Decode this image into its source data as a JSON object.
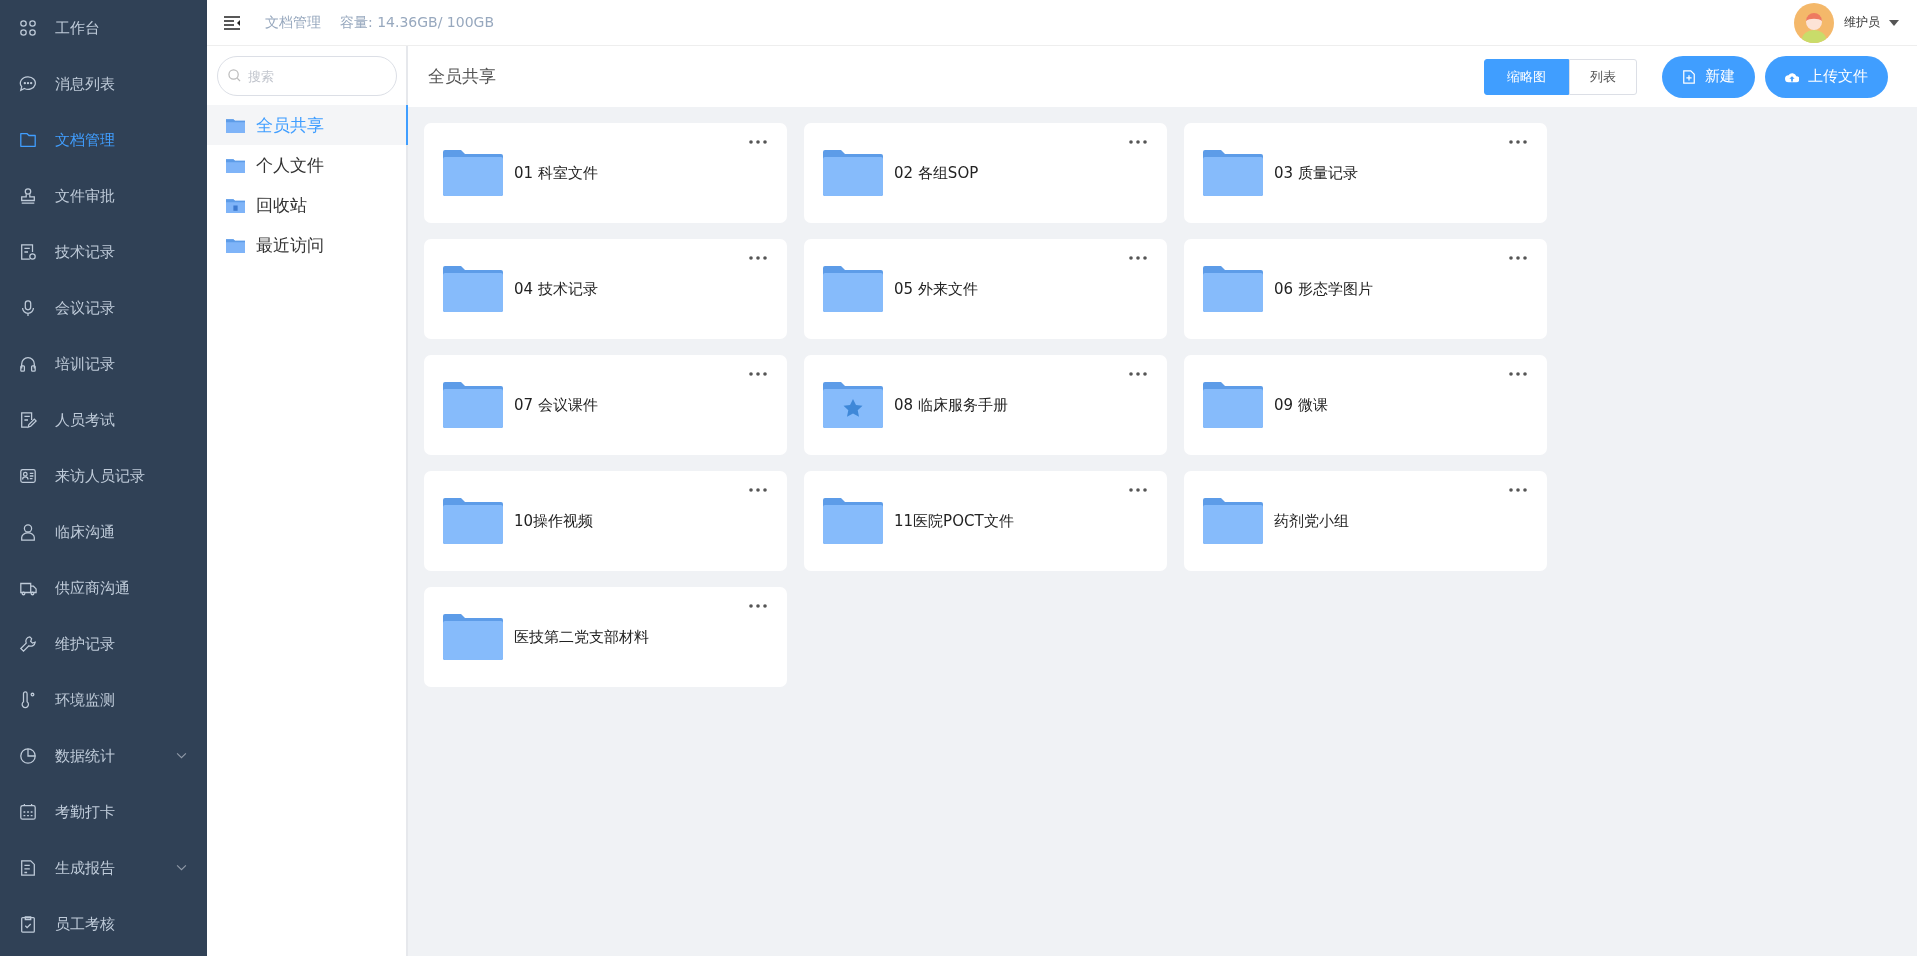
{
  "sidebar": {
    "items": [
      {
        "label": "工作台",
        "selected": false,
        "expandable": false
      },
      {
        "label": "消息列表",
        "selected": false,
        "expandable": false
      },
      {
        "label": "文档管理",
        "selected": true,
        "expandable": false
      },
      {
        "label": "文件审批",
        "selected": false,
        "expandable": false
      },
      {
        "label": "技术记录",
        "selected": false,
        "expandable": false
      },
      {
        "label": "会议记录",
        "selected": false,
        "expandable": false
      },
      {
        "label": "培训记录",
        "selected": false,
        "expandable": false
      },
      {
        "label": "人员考试",
        "selected": false,
        "expandable": false
      },
      {
        "label": "来访人员记录",
        "selected": false,
        "expandable": false
      },
      {
        "label": "临床沟通",
        "selected": false,
        "expandable": false
      },
      {
        "label": "供应商沟通",
        "selected": false,
        "expandable": false
      },
      {
        "label": "维护记录",
        "selected": false,
        "expandable": false
      },
      {
        "label": "环境监测",
        "selected": false,
        "expandable": false
      },
      {
        "label": "数据统计",
        "selected": false,
        "expandable": true
      },
      {
        "label": "考勤打卡",
        "selected": false,
        "expandable": false
      },
      {
        "label": "生成报告",
        "selected": false,
        "expandable": true
      },
      {
        "label": "员工考核",
        "selected": false,
        "expandable": false
      }
    ]
  },
  "header": {
    "breadcrumb": "文档管理",
    "capacity": "容量: 14.36GB/ 100GB",
    "user": "维护员"
  },
  "folder_panel": {
    "search": {
      "placeholder": "搜索"
    },
    "items": [
      {
        "label": "全员共享",
        "kind": "folder",
        "selected": true
      },
      {
        "label": "个人文件",
        "kind": "folder",
        "selected": false
      },
      {
        "label": "回收站",
        "kind": "trash",
        "selected": false
      },
      {
        "label": "最近访问",
        "kind": "folder",
        "selected": false
      }
    ]
  },
  "content": {
    "title": "全员共享",
    "view_toggle": [
      {
        "label": "缩略图",
        "selected": true
      },
      {
        "label": "列表",
        "selected": false
      }
    ],
    "buttons": [
      {
        "label": "新建",
        "kind": "new"
      },
      {
        "label": "上传文件",
        "kind": "upload"
      }
    ],
    "folders": [
      {
        "name": "01 科室文件",
        "starred": false
      },
      {
        "name": "02 各组SOP",
        "starred": false
      },
      {
        "name": "03 质量记录",
        "starred": false
      },
      {
        "name": "04 技术记录",
        "starred": false
      },
      {
        "name": "05 外来文件",
        "starred": false
      },
      {
        "name": "06 形态学图片",
        "starred": false
      },
      {
        "name": "07 会议课件",
        "starred": false
      },
      {
        "name": "08 临床服务手册",
        "starred": true
      },
      {
        "name": "09 微课",
        "starred": false
      },
      {
        "name": "10操作视频",
        "starred": false
      },
      {
        "name": "11医院POCT文件",
        "starred": false
      },
      {
        "name": "药剂党小组",
        "starred": false
      },
      {
        "name": "医技第二党支部材料",
        "starred": false
      }
    ]
  }
}
